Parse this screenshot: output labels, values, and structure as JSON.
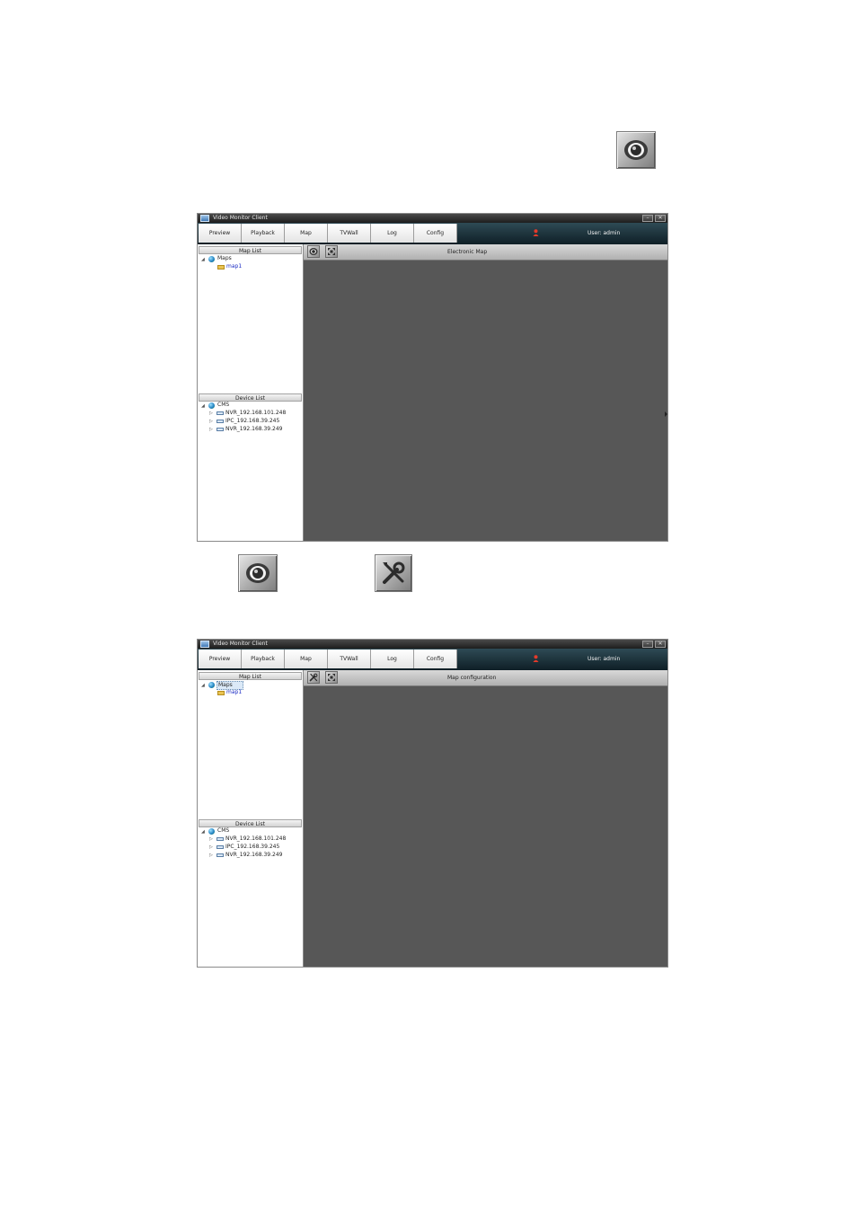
{
  "window": {
    "title": "Video Monitor Client",
    "minimize_glyph": "–",
    "close_glyph": "✕"
  },
  "nav": {
    "tabs": [
      {
        "label": "Preview"
      },
      {
        "label": "Playback"
      },
      {
        "label": "Map"
      },
      {
        "label": "TVWall"
      },
      {
        "label": "Log"
      },
      {
        "label": "Config"
      }
    ],
    "user": "User: admin"
  },
  "map_list": {
    "header": "Map List",
    "root": "Maps",
    "items": [
      "map1"
    ]
  },
  "device_list": {
    "header": "Device List",
    "root": "CMS",
    "devices": [
      "NVR_192.168.101.248",
      "IPC_192.168.39.245",
      "NVR_192.168.39.249"
    ]
  },
  "screen1": {
    "panel_title": "Electronic Map"
  },
  "screen2": {
    "panel_title": "Map configuration"
  },
  "icons": {
    "preview": "eye-icon",
    "config": "wrench-icon",
    "fullscreen": "expand-icon",
    "user": "user-icon"
  },
  "colors": {
    "map_area": "#575757",
    "navbar": "#1a2f37",
    "link": "#1b2bc4"
  }
}
